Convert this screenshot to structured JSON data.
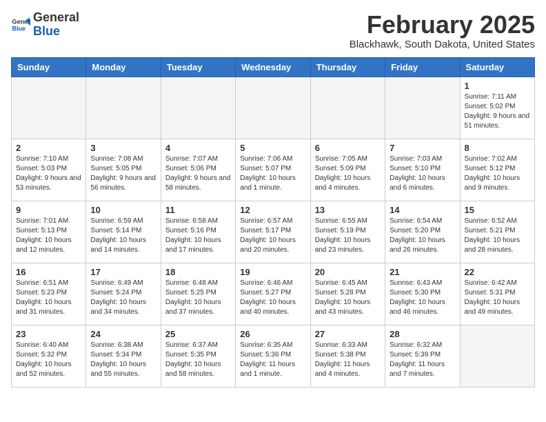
{
  "logo": {
    "general": "General",
    "blue": "Blue"
  },
  "title": "February 2025",
  "location": "Blackhawk, South Dakota, United States",
  "weekdays": [
    "Sunday",
    "Monday",
    "Tuesday",
    "Wednesday",
    "Thursday",
    "Friday",
    "Saturday"
  ],
  "weeks": [
    [
      {
        "day": "",
        "info": ""
      },
      {
        "day": "",
        "info": ""
      },
      {
        "day": "",
        "info": ""
      },
      {
        "day": "",
        "info": ""
      },
      {
        "day": "",
        "info": ""
      },
      {
        "day": "",
        "info": ""
      },
      {
        "day": "1",
        "info": "Sunrise: 7:11 AM\nSunset: 5:02 PM\nDaylight: 9 hours and 51 minutes."
      }
    ],
    [
      {
        "day": "2",
        "info": "Sunrise: 7:10 AM\nSunset: 5:03 PM\nDaylight: 9 hours and 53 minutes."
      },
      {
        "day": "3",
        "info": "Sunrise: 7:08 AM\nSunset: 5:05 PM\nDaylight: 9 hours and 56 minutes."
      },
      {
        "day": "4",
        "info": "Sunrise: 7:07 AM\nSunset: 5:06 PM\nDaylight: 9 hours and 58 minutes."
      },
      {
        "day": "5",
        "info": "Sunrise: 7:06 AM\nSunset: 5:07 PM\nDaylight: 10 hours and 1 minute."
      },
      {
        "day": "6",
        "info": "Sunrise: 7:05 AM\nSunset: 5:09 PM\nDaylight: 10 hours and 4 minutes."
      },
      {
        "day": "7",
        "info": "Sunrise: 7:03 AM\nSunset: 5:10 PM\nDaylight: 10 hours and 6 minutes."
      },
      {
        "day": "8",
        "info": "Sunrise: 7:02 AM\nSunset: 5:12 PM\nDaylight: 10 hours and 9 minutes."
      }
    ],
    [
      {
        "day": "9",
        "info": "Sunrise: 7:01 AM\nSunset: 5:13 PM\nDaylight: 10 hours and 12 minutes."
      },
      {
        "day": "10",
        "info": "Sunrise: 6:59 AM\nSunset: 5:14 PM\nDaylight: 10 hours and 14 minutes."
      },
      {
        "day": "11",
        "info": "Sunrise: 6:58 AM\nSunset: 5:16 PM\nDaylight: 10 hours and 17 minutes."
      },
      {
        "day": "12",
        "info": "Sunrise: 6:57 AM\nSunset: 5:17 PM\nDaylight: 10 hours and 20 minutes."
      },
      {
        "day": "13",
        "info": "Sunrise: 6:55 AM\nSunset: 5:19 PM\nDaylight: 10 hours and 23 minutes."
      },
      {
        "day": "14",
        "info": "Sunrise: 6:54 AM\nSunset: 5:20 PM\nDaylight: 10 hours and 26 minutes."
      },
      {
        "day": "15",
        "info": "Sunrise: 6:52 AM\nSunset: 5:21 PM\nDaylight: 10 hours and 28 minutes."
      }
    ],
    [
      {
        "day": "16",
        "info": "Sunrise: 6:51 AM\nSunset: 5:23 PM\nDaylight: 10 hours and 31 minutes."
      },
      {
        "day": "17",
        "info": "Sunrise: 6:49 AM\nSunset: 5:24 PM\nDaylight: 10 hours and 34 minutes."
      },
      {
        "day": "18",
        "info": "Sunrise: 6:48 AM\nSunset: 5:25 PM\nDaylight: 10 hours and 37 minutes."
      },
      {
        "day": "19",
        "info": "Sunrise: 6:46 AM\nSunset: 5:27 PM\nDaylight: 10 hours and 40 minutes."
      },
      {
        "day": "20",
        "info": "Sunrise: 6:45 AM\nSunset: 5:28 PM\nDaylight: 10 hours and 43 minutes."
      },
      {
        "day": "21",
        "info": "Sunrise: 6:43 AM\nSunset: 5:30 PM\nDaylight: 10 hours and 46 minutes."
      },
      {
        "day": "22",
        "info": "Sunrise: 6:42 AM\nSunset: 5:31 PM\nDaylight: 10 hours and 49 minutes."
      }
    ],
    [
      {
        "day": "23",
        "info": "Sunrise: 6:40 AM\nSunset: 5:32 PM\nDaylight: 10 hours and 52 minutes."
      },
      {
        "day": "24",
        "info": "Sunrise: 6:38 AM\nSunset: 5:34 PM\nDaylight: 10 hours and 55 minutes."
      },
      {
        "day": "25",
        "info": "Sunrise: 6:37 AM\nSunset: 5:35 PM\nDaylight: 10 hours and 58 minutes."
      },
      {
        "day": "26",
        "info": "Sunrise: 6:35 AM\nSunset: 5:36 PM\nDaylight: 11 hours and 1 minute."
      },
      {
        "day": "27",
        "info": "Sunrise: 6:33 AM\nSunset: 5:38 PM\nDaylight: 11 hours and 4 minutes."
      },
      {
        "day": "28",
        "info": "Sunrise: 6:32 AM\nSunset: 5:39 PM\nDaylight: 11 hours and 7 minutes."
      },
      {
        "day": "",
        "info": ""
      }
    ]
  ]
}
